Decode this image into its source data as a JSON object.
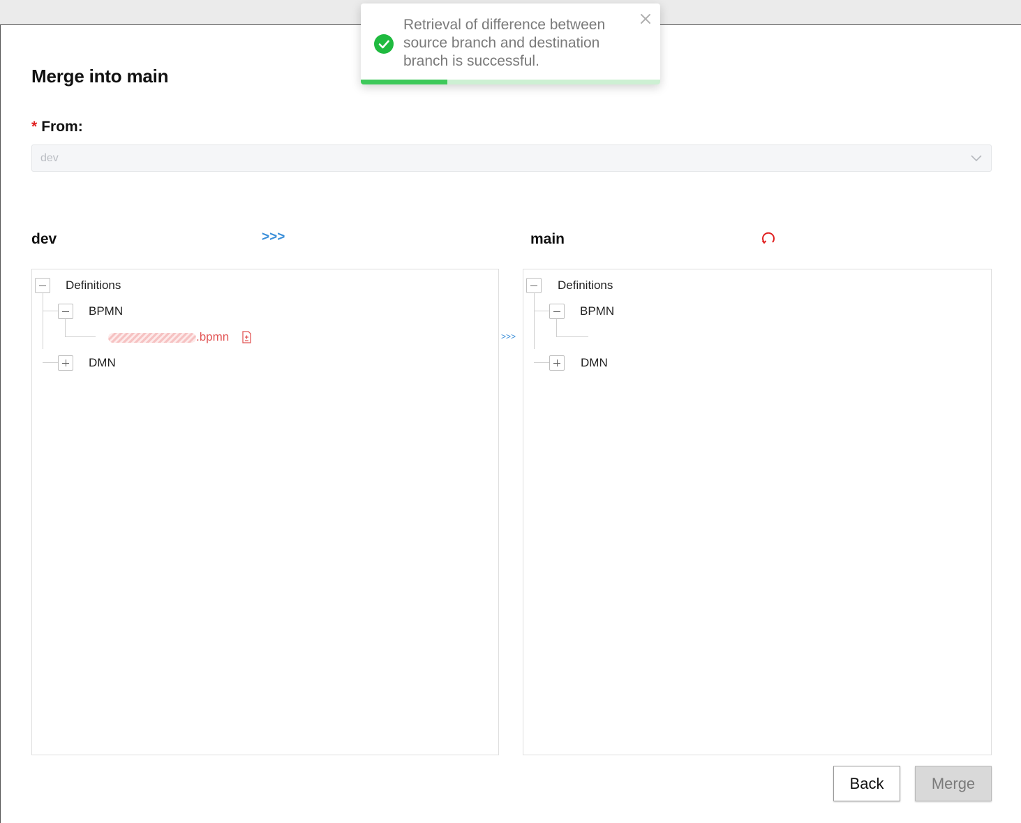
{
  "page": {
    "title": "Merge into main",
    "from_required_mark": "*",
    "from_label": "From:",
    "from_value": "dev"
  },
  "source": {
    "branch": "dev",
    "compare_arrows": ">>>",
    "tree": {
      "root": "Definitions",
      "bpmn": "BPMN",
      "file_suffix": ".bpmn",
      "dmn": "DMN"
    }
  },
  "middle": {
    "arrows": ">>>"
  },
  "destination": {
    "branch": "main",
    "tree": {
      "root": "Definitions",
      "bpmn": "BPMN",
      "dmn": "DMN"
    }
  },
  "buttons": {
    "back": "Back",
    "merge": "Merge"
  },
  "toast": {
    "message": "Retrieval of difference between source branch and destination branch is successful.",
    "progress": 0.29
  },
  "colors": {
    "accent_blue": "#3b8fd9",
    "success_green": "#1fba3f",
    "diff_red": "#e25757",
    "required_red": "#e02020"
  },
  "icons": {
    "toast_status": "check-circle-icon",
    "toast_close": "close-icon",
    "select_chevron": "chevron-down-icon",
    "refresh": "refresh-icon",
    "file_diff": "file-diff-icon"
  }
}
